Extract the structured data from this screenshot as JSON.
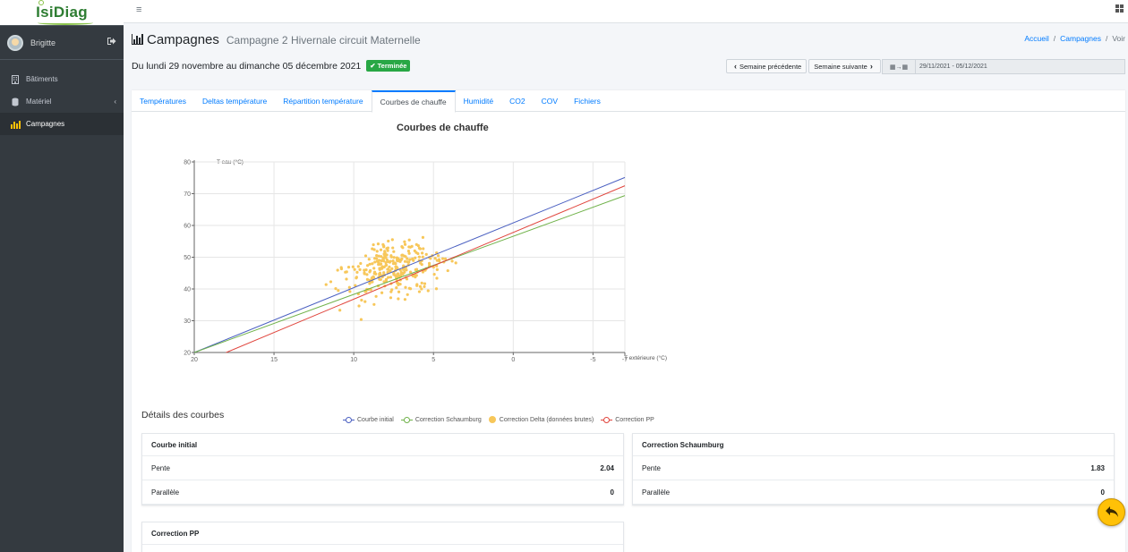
{
  "brand": {
    "name": "IsiDiag"
  },
  "user": {
    "name": "Brigitte"
  },
  "sidebar": {
    "items": [
      {
        "label": "Bâtiments",
        "icon": "building-icon"
      },
      {
        "label": "Matériel",
        "icon": "database-icon"
      },
      {
        "label": "Campagnes",
        "icon": "chart-bar-icon"
      }
    ]
  },
  "header": {
    "title": "Campagnes",
    "subtitle": "Campagne 2 Hivernale circuit Maternelle",
    "breadcrumb": [
      "Accueil",
      "Campagnes",
      "Voir"
    ],
    "period": "Du lundi 29 novembre au dimanche 05 décembre 2021",
    "status": "Terminée",
    "prev_week": "Semaine précédente",
    "next_week": "Semaine suivante",
    "date_range": "29/11/2021 - 05/12/2021"
  },
  "tabs": [
    "Températures",
    "Deltas température",
    "Répartition température",
    "Courbes de chauffe",
    "Humidité",
    "CO2",
    "COV",
    "Fichiers"
  ],
  "active_tab": "Courbes de chauffe",
  "chart_data": {
    "type": "scatter",
    "title": "Courbes de chauffe",
    "xlabel": "T extérieure (°C)",
    "ylabel": "T eau (°C)",
    "xlim": [
      20,
      -7
    ],
    "ylim": [
      20,
      80
    ],
    "x_ticks": [
      20,
      15,
      10,
      5,
      0,
      -5,
      -7
    ],
    "y_ticks": [
      20,
      30,
      40,
      50,
      60,
      70,
      80
    ],
    "grid": true,
    "legend_position": "bottom",
    "series": [
      {
        "name": "Courbe initial",
        "kind": "line",
        "color": "#4a5fc1",
        "x": [
          20,
          -7
        ],
        "y": [
          20,
          75.1
        ]
      },
      {
        "name": "Correction Schaumburg",
        "kind": "line",
        "color": "#70b24a",
        "x": [
          20,
          -7
        ],
        "y": [
          20,
          69.4
        ]
      },
      {
        "name": "Correction Delta (données brutes)",
        "kind": "scatter",
        "color": "#f7c75a"
      },
      {
        "name": "Correction PP",
        "kind": "line",
        "color": "#e0443c",
        "x": [
          18,
          -7
        ],
        "y": [
          20,
          72.5
        ]
      }
    ]
  },
  "details": {
    "title": "Détails des courbes",
    "cards": [
      {
        "title": "Courbe initial",
        "rows": [
          {
            "label": "Pente",
            "value": "2.04"
          },
          {
            "label": "Parallèle",
            "value": "0"
          }
        ]
      },
      {
        "title": "Correction Schaumburg",
        "rows": [
          {
            "label": "Pente",
            "value": "1.83"
          },
          {
            "label": "Parallèle",
            "value": "0"
          }
        ]
      },
      {
        "title": "Correction PP",
        "rows": []
      }
    ]
  },
  "colors": {
    "primary": "#007bff",
    "success": "#28a745",
    "sidebar": "#343a40",
    "accent": "#ffc107"
  }
}
